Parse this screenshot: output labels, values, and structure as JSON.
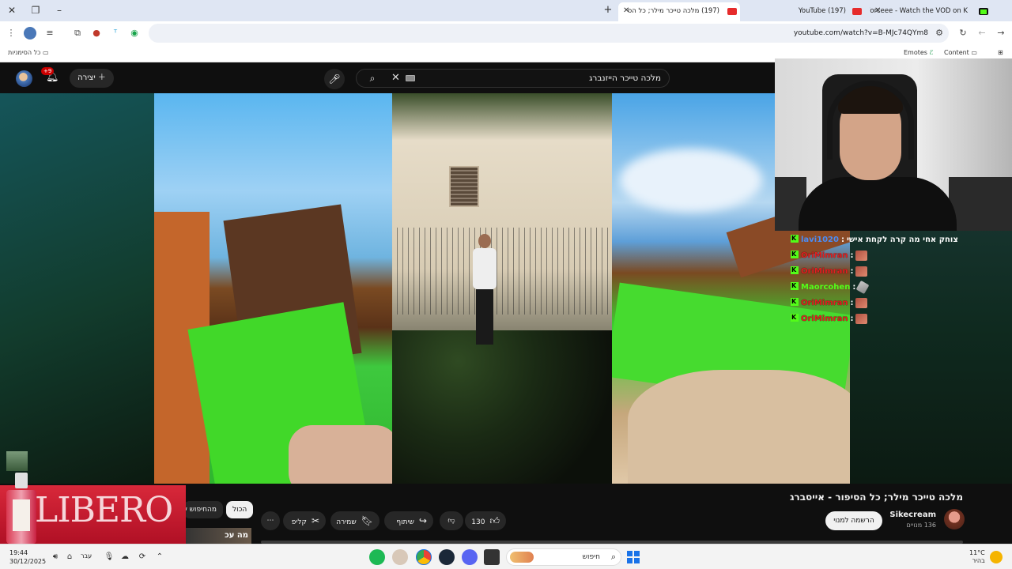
{
  "browser": {
    "tabs": [
      {
        "label": "Forceee - Watch the VOD on K",
        "favicon": "kick-icon",
        "active": false
      },
      {
        "label": "(197) YouTube",
        "favicon": "youtube-icon",
        "active": false
      },
      {
        "label": "(197) מלכה טייכר מילר; כל הס",
        "favicon": "youtube-icon",
        "active": true
      }
    ],
    "url": "youtube.com/watch?v=B-MJc74QYm8",
    "bookmarks": {
      "left": "כל הסימניות",
      "right": [
        "Content",
        "Emotes"
      ]
    }
  },
  "youtube": {
    "search_query": "מלכה טייכר הייזנברג",
    "create_label": "יצירה",
    "notifications_badge": "+9",
    "video": {
      "title": "מלכה טייכר מילר; כל הסיפור - אייסברג",
      "channel": "Sikecream",
      "subscribers": "136 מנויים",
      "subscribe_label": "הרשמה למנוי",
      "likes": "130",
      "share_label": "שיתוף",
      "save_label": "שמירה",
      "clip_label": "קליפ"
    },
    "filters": [
      "הכול",
      "מהחיפוש ש"
    ],
    "thumbnail_text": "מה עכ"
  },
  "chat": [
    {
      "user": "lavi1020",
      "color": "blue",
      "message": "צוחק אחי מה קרה לקחת אישי",
      "emote": ""
    },
    {
      "user": "OriMimran",
      "color": "red",
      "message": "",
      "emote": "emote-face"
    },
    {
      "user": "OriMimran",
      "color": "red",
      "message": "",
      "emote": "emote-face"
    },
    {
      "user": "Maorcohen",
      "color": "green",
      "message": "",
      "emote": "emote-feather"
    },
    {
      "user": "OriMimran",
      "color": "red",
      "message": "",
      "emote": "emote-face"
    },
    {
      "user": "OriMimran",
      "color": "red",
      "message": "",
      "emote": "emote-face"
    }
  ],
  "ad": {
    "brand": "LIBERO"
  },
  "taskbar": {
    "time": "19:44",
    "date": "30/12/2025",
    "language": "עבר",
    "search_placeholder": "חיפוש",
    "weather_temp": "11°C",
    "weather_desc": "בהיר"
  },
  "colors": {
    "accent_red": "#cc0000",
    "kick_green": "#53fc18",
    "chat_blue": "#4b8df6"
  }
}
